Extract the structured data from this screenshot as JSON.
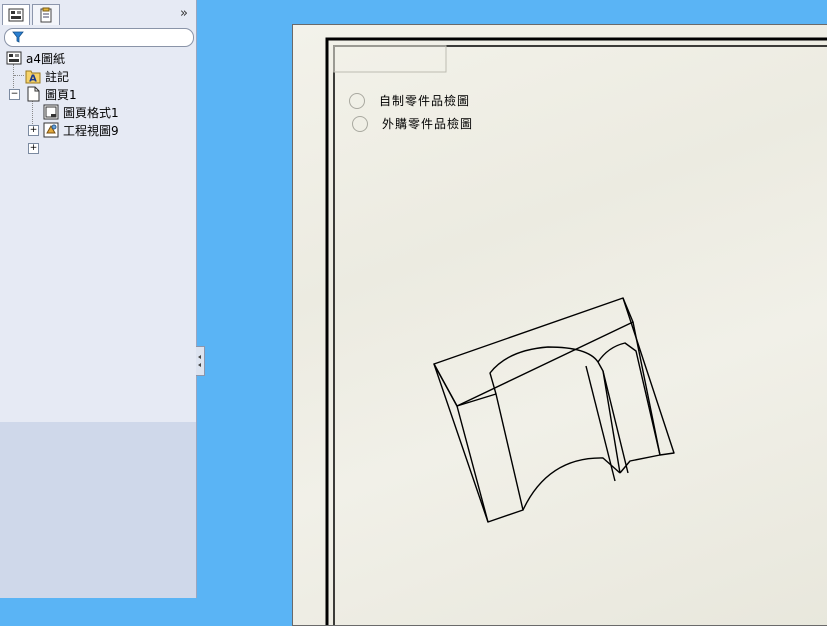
{
  "sidebar": {
    "tabs": [
      {
        "icon": "feature-tree-icon",
        "active": true
      },
      {
        "icon": "property-manager-icon",
        "active": false
      }
    ],
    "collapse_glyph": "»",
    "filter_icon": "filter-icon",
    "tree": [
      {
        "label": "a4圖紙",
        "icon": "drawing-icon"
      },
      {
        "label": "註記",
        "icon": "annotation-icon"
      },
      {
        "label": "圖頁1",
        "icon": "sheet-icon",
        "expander": "−"
      },
      {
        "label": "圖頁格式1",
        "icon": "sheet-format-icon",
        "expander": "+"
      },
      {
        "label": "工程視圖9",
        "icon": "drawing-view-icon",
        "expander": "+"
      }
    ]
  },
  "header": {
    "title_fragment": "· · · ·"
  },
  "drawing": {
    "checklist": [
      {
        "label": "自制零件品檢圖",
        "checked": false
      },
      {
        "label": "外購零件品檢圖",
        "checked": false
      }
    ]
  },
  "colors": {
    "canvas_bg": "#5ab4f5",
    "sidebar_bg": "#e6eaf4",
    "paper": "#efeee5",
    "line": "#000000"
  }
}
